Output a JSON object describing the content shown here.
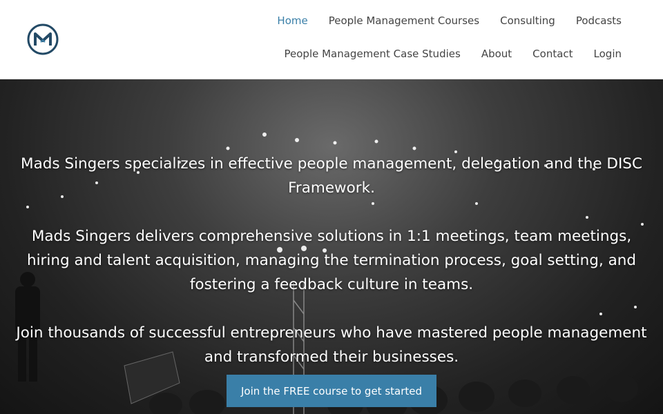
{
  "header": {
    "nav_row1": [
      "Home",
      "People Management Courses",
      "Consulting",
      "Podcasts"
    ],
    "nav_row2": [
      "People Management Case Studies",
      "About",
      "Contact",
      "Login"
    ],
    "active_color": "#3a7fa8"
  },
  "logo": {
    "icon": "m-logo-icon"
  },
  "hero": {
    "paragraph1": "Mads Singers specializes in effective people management, delegation and the DISC Framework.",
    "paragraph2": "Mads Singers delivers comprehensive solutions in 1:1 meetings, team meetings, hiring and talent acquisition, managing the termination process, goal setting, and fostering a feedback culture in teams.",
    "paragraph3": "Join thousands of successful entrepreneurs who have mastered people management and transformed their businesses.",
    "cta_label": "Join the FREE course to get started",
    "cta_color": "#3a7fa8"
  }
}
